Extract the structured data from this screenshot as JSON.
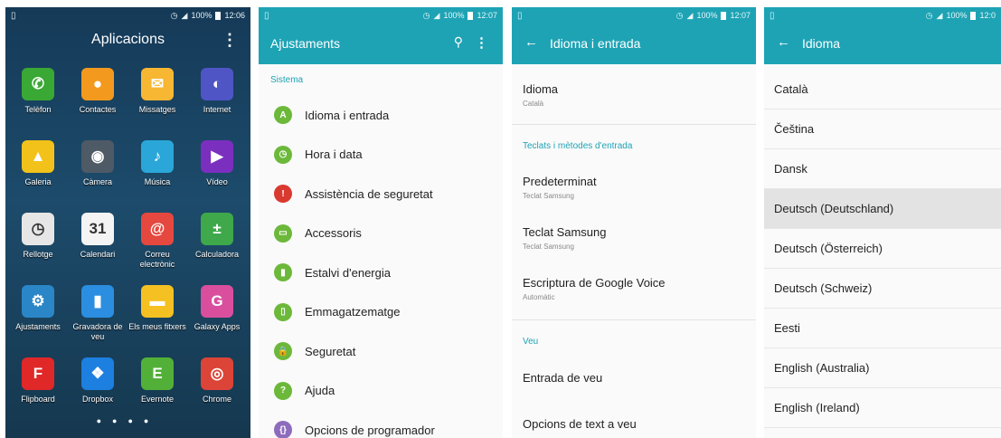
{
  "screen1": {
    "status": {
      "time": "12:06",
      "battery": "100%"
    },
    "title": "Aplicacions",
    "more": "⋮",
    "apps": [
      {
        "label": "Telèfon",
        "icon": "phone-icon",
        "glyph": "✆",
        "color": "#3aa835"
      },
      {
        "label": "Contactes",
        "icon": "contacts-icon",
        "glyph": "●",
        "color": "#f39a1e"
      },
      {
        "label": "Missatges",
        "icon": "messages-icon",
        "glyph": "✉",
        "color": "#f7b733"
      },
      {
        "label": "Internet",
        "icon": "internet-icon",
        "glyph": "◐",
        "color": "#4f55c5"
      },
      {
        "label": "Galeria",
        "icon": "gallery-icon",
        "glyph": "▲",
        "color": "#f2c21a"
      },
      {
        "label": "Càmera",
        "icon": "camera-icon",
        "glyph": "◉",
        "color": "#4e5a66"
      },
      {
        "label": "Música",
        "icon": "music-icon",
        "glyph": "♪",
        "color": "#2aa7d8"
      },
      {
        "label": "Vídeo",
        "icon": "video-icon",
        "glyph": "▶",
        "color": "#7b2fbf"
      },
      {
        "label": "Rellotge",
        "icon": "clock-icon",
        "glyph": "◷",
        "color": "#e6e6e6"
      },
      {
        "label": "Calendari",
        "icon": "calendar-icon",
        "glyph": "31",
        "color": "#f4f4f4"
      },
      {
        "label": "Correu electrònic",
        "icon": "email-icon",
        "glyph": "@",
        "color": "#e5483e"
      },
      {
        "label": "Calculadora",
        "icon": "calculator-icon",
        "glyph": "±",
        "color": "#3ea84a"
      },
      {
        "label": "Ajustaments",
        "icon": "settings-gear-icon",
        "glyph": "⚙",
        "color": "#2a86c7"
      },
      {
        "label": "Gravadora de veu",
        "icon": "voice-recorder-icon",
        "glyph": "▮",
        "color": "#2b8ee0"
      },
      {
        "label": "Els meus fitxers",
        "icon": "folder-icon",
        "glyph": "▬",
        "color": "#f5c022"
      },
      {
        "label": "Galaxy Apps",
        "icon": "galaxy-apps-icon",
        "glyph": "G",
        "color": "#d94f9d"
      },
      {
        "label": "Flipboard",
        "icon": "flipboard-icon",
        "glyph": "F",
        "color": "#e12828"
      },
      {
        "label": "Dropbox",
        "icon": "dropbox-icon",
        "glyph": "❖",
        "color": "#1d7fe0"
      },
      {
        "label": "Evernote",
        "icon": "evernote-icon",
        "glyph": "E",
        "color": "#52b038"
      },
      {
        "label": "Chrome",
        "icon": "chrome-icon",
        "glyph": "◎",
        "color": "#db4437"
      }
    ]
  },
  "screen2": {
    "status": {
      "time": "12:07",
      "battery": "100%"
    },
    "title": "Ajustaments",
    "search_icon": "search-icon",
    "section": "Sistema",
    "items": [
      {
        "label": "Idioma i entrada",
        "color": "#6cb83a",
        "glyph": "A"
      },
      {
        "label": "Hora i data",
        "color": "#6cb83a",
        "glyph": "◷"
      },
      {
        "label": "Assistència de seguretat",
        "color": "#d9392f",
        "glyph": "!"
      },
      {
        "label": "Accessoris",
        "color": "#6cb83a",
        "glyph": "▭"
      },
      {
        "label": "Estalvi d'energia",
        "color": "#6cb83a",
        "glyph": "▮"
      },
      {
        "label": "Emmagatzematge",
        "color": "#6cb83a",
        "glyph": "▯"
      },
      {
        "label": "Seguretat",
        "color": "#6cb83a",
        "glyph": "🔒"
      },
      {
        "label": "Ajuda",
        "color": "#6cb83a",
        "glyph": "?"
      },
      {
        "label": "Opcions de programador",
        "color": "#8d6bbd",
        "glyph": "{}"
      }
    ]
  },
  "screen3": {
    "status": {
      "time": "12:07",
      "battery": "100%"
    },
    "title": "Idioma i entrada",
    "language": {
      "label": "Idioma",
      "value": "Català"
    },
    "keyboards_section": "Teclats i mètodes d'entrada",
    "keyboards": [
      {
        "label": "Predeterminat",
        "sub": "Teclat Samsung"
      },
      {
        "label": "Teclat Samsung",
        "sub": "Teclat Samsung"
      },
      {
        "label": "Escriptura de Google Voice",
        "sub": "Automàtic"
      }
    ],
    "voice_section": "Veu",
    "voice": [
      {
        "label": "Entrada de veu"
      },
      {
        "label": "Opcions de text a veu"
      }
    ]
  },
  "screen4": {
    "status": {
      "time": "12:0",
      "battery": "100%"
    },
    "title": "Idioma",
    "languages": [
      "Català",
      "Čeština",
      "Dansk",
      "Deutsch (Deutschland)",
      "Deutsch (Österreich)",
      "Deutsch (Schweiz)",
      "Eesti",
      "English (Australia)",
      "English (Ireland)"
    ],
    "selected_index": 3
  }
}
